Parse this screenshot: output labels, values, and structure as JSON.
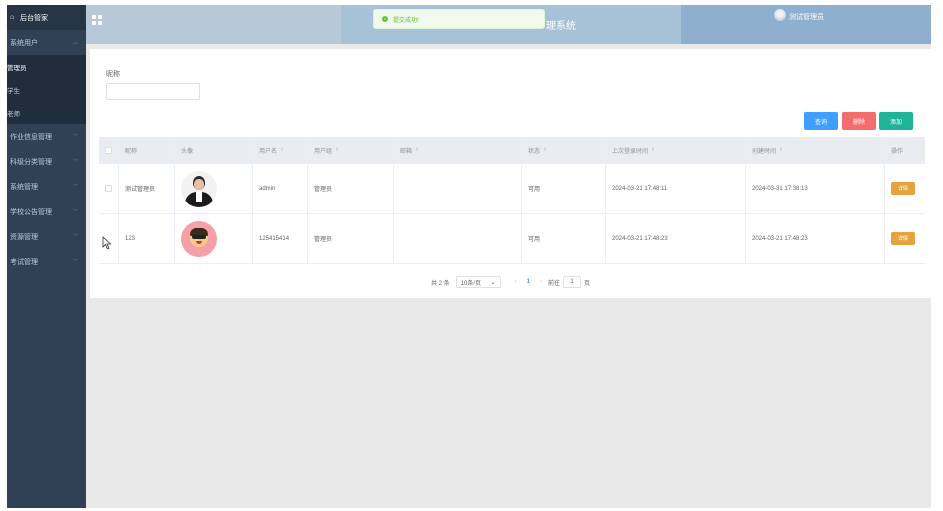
{
  "sidebar": {
    "title": "后台管家",
    "group_system_users": "系统用户",
    "subitems": [
      "管理员",
      "学生",
      "老师"
    ],
    "groups": [
      "作业信息管理",
      "科级分类管理",
      "系统管理",
      "学校公告管理",
      "资源管理",
      "考试管理"
    ]
  },
  "header": {
    "title": "理系统",
    "username": "测试管理员"
  },
  "toast": {
    "message": "提交成功!"
  },
  "search": {
    "label": "昵称",
    "value": ""
  },
  "buttons": {
    "query": "查询",
    "delete": "删除",
    "add": "添加"
  },
  "table": {
    "columns": [
      "昵称",
      "头像",
      "用户名",
      "用户组",
      "邮箱",
      "状态",
      "上次登录时间",
      "创建时间",
      "操作"
    ],
    "rows": [
      {
        "nickname": "测试管理员",
        "username": "admin",
        "group": "管理员",
        "email": "",
        "status": "可用",
        "last_login": "2024-03-21 17:48:11",
        "created": "2024-03-31 17:38:13",
        "action": "详情"
      },
      {
        "nickname": "123",
        "username": "125415414",
        "group": "管理员",
        "email": "",
        "status": "可用",
        "last_login": "2024-03-21 17:48:23",
        "created": "2024-03-21 17:48:23",
        "action": "详情"
      }
    ]
  },
  "pagination": {
    "total": "共 2 条",
    "page_size": "10条/页",
    "current": "1",
    "goto_label": "前往",
    "goto_value": "1",
    "page_suffix": "页"
  },
  "colors": {
    "sidebar": "#304156",
    "header": "#b7c8d8",
    "primary": "#409eff",
    "danger": "#f56c6c",
    "success": "#1fb49a",
    "warning": "#e6a23c"
  }
}
